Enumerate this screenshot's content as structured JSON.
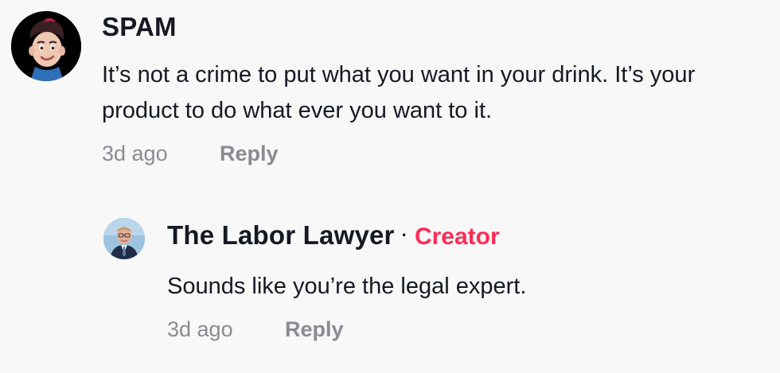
{
  "comment": {
    "username": "SPAM",
    "text": "It’s not a crime to put what you want in your drink. It’s your product to do what ever you want to it.",
    "time": "3d ago",
    "reply_label": "Reply",
    "avatar_icon": "memoji-avatar-icon"
  },
  "reply": {
    "username": "The Labor Lawyer",
    "separator": "·",
    "badge": "Creator",
    "text": "Sounds like you’re the legal expert.",
    "time": "3d ago",
    "reply_label": "Reply",
    "avatar_icon": "profile-photo-avatar-icon"
  },
  "colors": {
    "background": "#f8f8f8",
    "text": "#161823",
    "muted": "#8a8b91",
    "creator_badge": "#fe2c55"
  }
}
